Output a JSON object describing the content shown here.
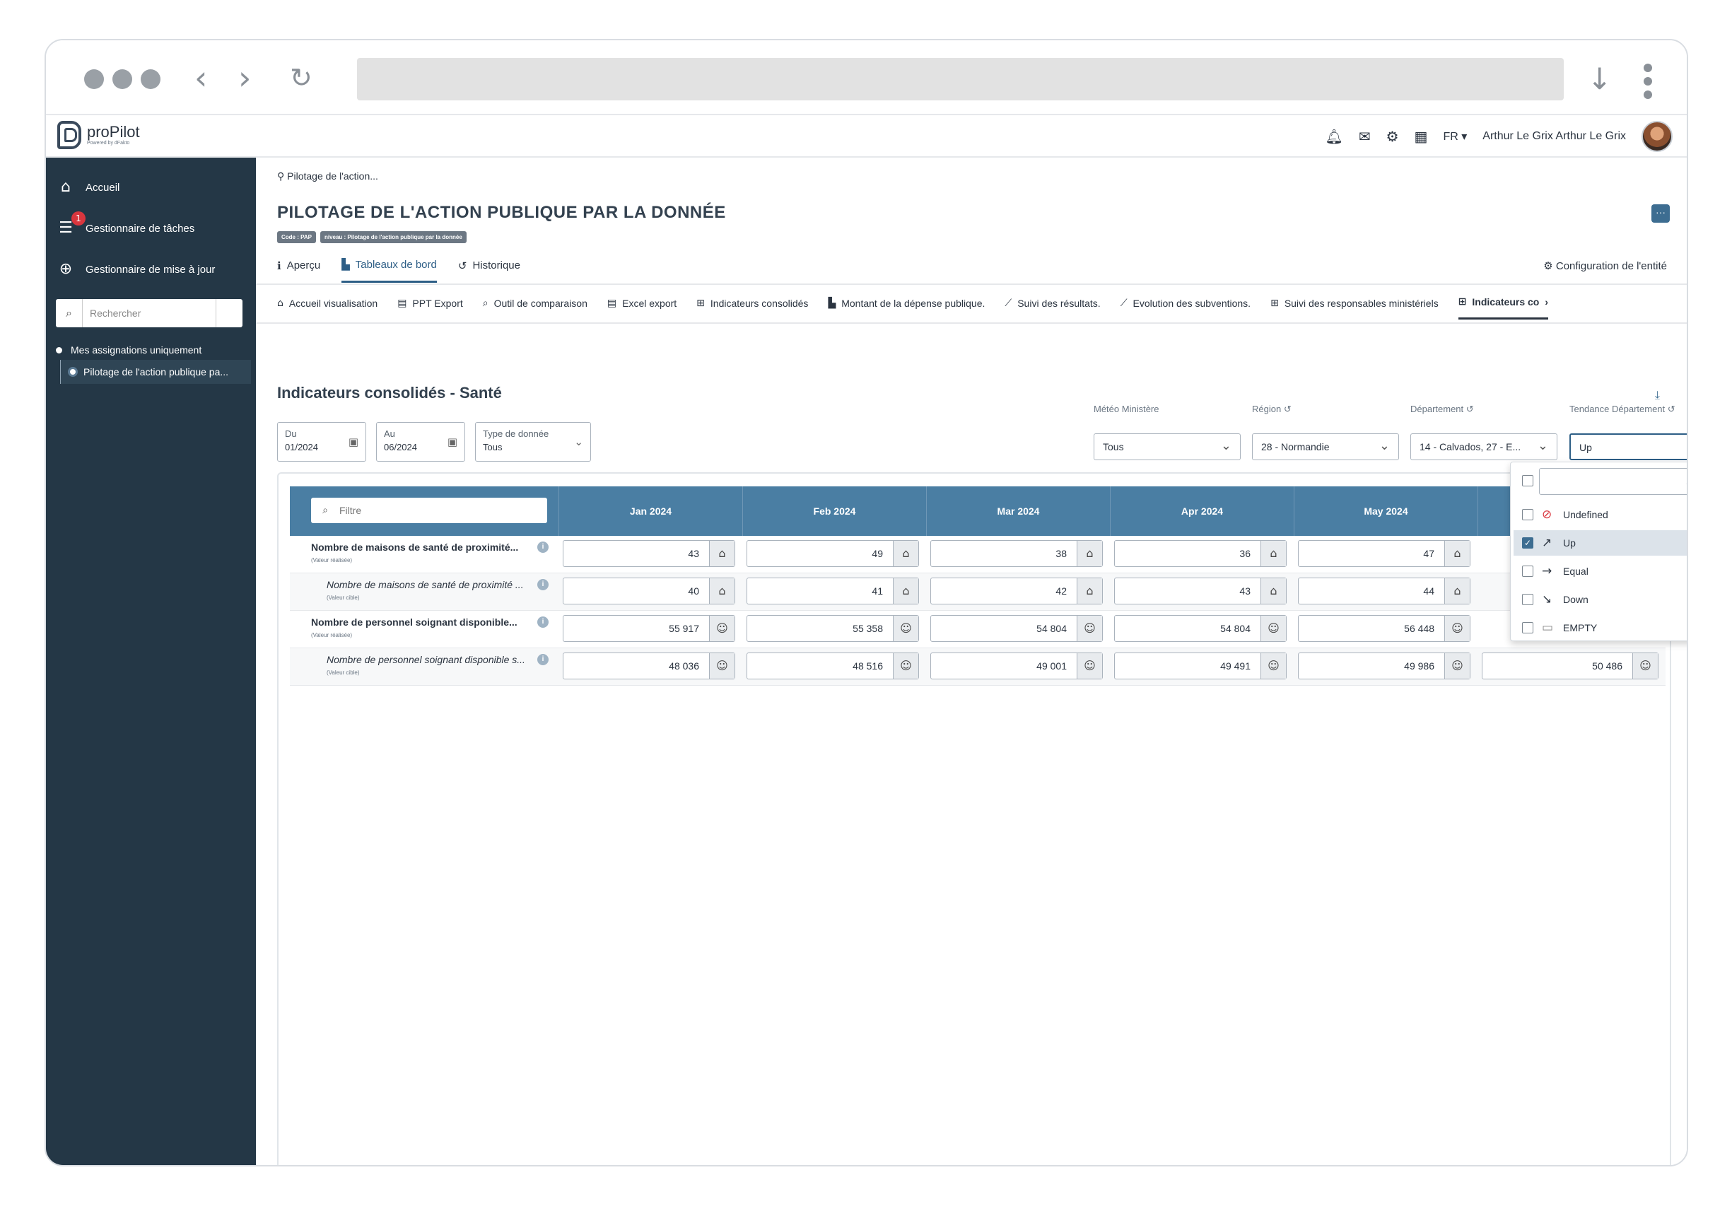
{
  "app": {
    "name": "proPilot",
    "tagline": "Powered by dFakto"
  },
  "topbar": {
    "lang": "FR",
    "user": "Arthur Le Grix Arthur Le Grix"
  },
  "sidebar": {
    "items": [
      {
        "label": "Accueil",
        "icon": "home-icon"
      },
      {
        "label": "Gestionnaire de tâches",
        "icon": "tasks-icon",
        "badge": "1"
      },
      {
        "label": "Gestionnaire de mise à jour",
        "icon": "update-icon"
      }
    ],
    "search_placeholder": "Rechercher",
    "tree_root": "Mes assignations uniquement",
    "tree_child": "Pilotage de l'action publique pa..."
  },
  "page": {
    "breadcrumb": "Pilotage de l'action...",
    "title": "PILOTAGE DE L'ACTION PUBLIQUE PAR LA DONNÉE",
    "tags": [
      "Code : PAP",
      "niveau : Pilotage de l'action publique par la donnée"
    ],
    "tabs": [
      {
        "label": "Aperçu"
      },
      {
        "label": "Tableaux de bord"
      },
      {
        "label": "Historique"
      }
    ],
    "config": "Configuration de l'entité",
    "subtabs": [
      {
        "label": "Accueil visualisation"
      },
      {
        "label": "PPT Export"
      },
      {
        "label": "Outil de comparaison"
      },
      {
        "label": "Excel export"
      },
      {
        "label": "Indicateurs consolidés"
      },
      {
        "label": "Montant de la dépense publique."
      },
      {
        "label": "Suivi des résultats."
      },
      {
        "label": "Evolution des subventions."
      },
      {
        "label": "Suivi des responsables ministériels"
      },
      {
        "label": "Indicateurs co"
      }
    ]
  },
  "panel": {
    "title": "Indicateurs consolidés - Santé",
    "date_from_label": "Du",
    "date_from": "01/2024",
    "date_to_label": "Au",
    "date_to": "06/2024",
    "type_label": "Type de donnée",
    "type_value": "Tous",
    "filters": [
      {
        "label": "Météo Ministère",
        "value": "Tous"
      },
      {
        "label": "Région",
        "value": "28 - Normandie"
      },
      {
        "label": "Département",
        "value": "14 - Calvados, 27 - E..."
      },
      {
        "label": "Tendance Département",
        "value": "Up"
      }
    ]
  },
  "table": {
    "filter_placeholder": "Filtre",
    "months": [
      "Jan 2024",
      "Feb 2024",
      "Mar 2024",
      "Apr 2024",
      "May 2024"
    ],
    "rows": [
      {
        "label": "Nombre de maisons de santé de proximité...",
        "sub": "(Valeur réalisée)",
        "values": [
          "43",
          "49",
          "38",
          "36",
          "47"
        ]
      },
      {
        "label": "Nombre de maisons de santé de proximité ...",
        "sub": "(Valeur cible)",
        "values": [
          "40",
          "41",
          "42",
          "43",
          "44"
        ]
      },
      {
        "label": "Nombre de personnel soignant disponible...",
        "sub": "(Valeur réalisée)",
        "values": [
          "55 917",
          "55 358",
          "54 804",
          "54 804",
          "56 448"
        ]
      },
      {
        "label": "Nombre de personnel soignant disponible s...",
        "sub": "(Valeur cible)",
        "values": [
          "48 036",
          "48 516",
          "49 001",
          "49 491",
          "49 986",
          "50 486"
        ]
      }
    ]
  },
  "dropdown": {
    "options": [
      {
        "label": "Undefined",
        "icon": "undefined-icon",
        "checked": false
      },
      {
        "label": "Up",
        "icon": "trend-up-icon",
        "checked": true
      },
      {
        "label": "Equal",
        "icon": "trend-equal-icon",
        "checked": false
      },
      {
        "label": "Down",
        "icon": "trend-down-icon",
        "checked": false
      },
      {
        "label": "EMPTY",
        "icon": "empty-icon",
        "checked": false
      }
    ]
  },
  "colors": {
    "sidebar": "#243746",
    "accent": "#2d5e86",
    "table_header": "#4a7ea3"
  }
}
